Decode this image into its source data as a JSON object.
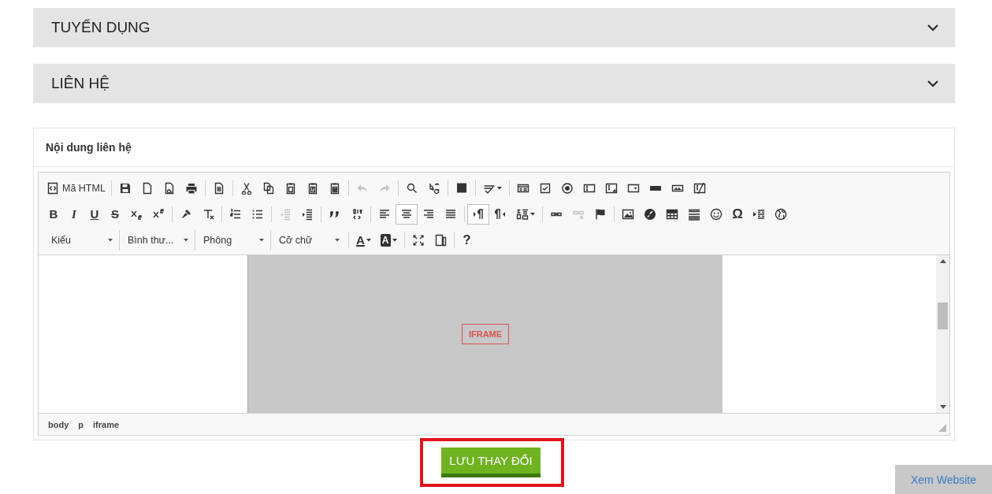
{
  "sections": [
    {
      "title": "TUYỂN DỤNG",
      "expanded": false
    },
    {
      "title": "LIÊN HỆ",
      "expanded": false
    }
  ],
  "editor_card": {
    "title": "Nội dung liên hệ",
    "toolbar": [
      [
        {
          "kind": "button",
          "label": "Mã HTML",
          "on": false,
          "disabled": false
        },
        {
          "kind": "separator"
        },
        {
          "kind": "button",
          "on": false,
          "disabled": false
        },
        {
          "kind": "button",
          "on": false,
          "disabled": false
        },
        {
          "kind": "button",
          "on": false,
          "disabled": false
        },
        {
          "kind": "button",
          "on": false,
          "disabled": false
        },
        {
          "kind": "separator"
        },
        {
          "kind": "button",
          "on": false,
          "disabled": false
        },
        {
          "kind": "separator"
        },
        {
          "kind": "button",
          "on": false,
          "disabled": false
        },
        {
          "kind": "button",
          "on": false,
          "disabled": false
        },
        {
          "kind": "button",
          "on": false,
          "disabled": false
        },
        {
          "kind": "button",
          "on": false,
          "disabled": false
        },
        {
          "kind": "button",
          "on": false,
          "disabled": false
        },
        {
          "kind": "separator"
        },
        {
          "kind": "button",
          "on": false,
          "disabled": true
        },
        {
          "kind": "button",
          "on": false,
          "disabled": true
        },
        {
          "kind": "separator"
        },
        {
          "kind": "button",
          "on": false,
          "disabled": false
        },
        {
          "kind": "button",
          "on": false,
          "disabled": false
        },
        {
          "kind": "separator"
        },
        {
          "kind": "button",
          "on": false,
          "disabled": false
        },
        {
          "kind": "separator"
        },
        {
          "kind": "menu-button",
          "on": false,
          "disabled": false
        },
        {
          "kind": "separator"
        },
        {
          "kind": "button",
          "on": false,
          "disabled": false
        },
        {
          "kind": "button",
          "disabled": false
        },
        {
          "kind": "button",
          "disabled": false
        },
        {
          "kind": "button",
          "on": false,
          "disabled": false
        },
        {
          "kind": "button",
          "on": false,
          "disabled": false
        },
        {
          "kind": "button",
          "on": false,
          "disabled": false
        },
        {
          "kind": "button",
          "on": false,
          "disabled": false
        },
        {
          "kind": "button",
          "on": false,
          "disabled": false
        },
        {
          "kind": "button",
          "on": false,
          "disabled": false
        }
      ],
      [
        {
          "kind": "button",
          "glyph": "B",
          "on": false,
          "disabled": false
        },
        {
          "kind": "button",
          "glyph": "I",
          "on": false,
          "disabled": false
        },
        {
          "kind": "button",
          "glyph": "U",
          "on": false,
          "disabled": false
        },
        {
          "kind": "button",
          "glyph": "S",
          "on": false,
          "disabled": false
        },
        {
          "kind": "button",
          "on": false,
          "disabled": false
        },
        {
          "kind": "button",
          "on": false,
          "disabled": false
        },
        {
          "kind": "separator"
        },
        {
          "kind": "button",
          "on": false,
          "disabled": false
        },
        {
          "kind": "button",
          "on": false,
          "disabled": false
        },
        {
          "kind": "separator"
        },
        {
          "kind": "button",
          "on": false,
          "disabled": false
        },
        {
          "kind": "button",
          "on": false,
          "disabled": false
        },
        {
          "kind": "separator"
        },
        {
          "kind": "button",
          "on": false,
          "disabled": true
        },
        {
          "kind": "button",
          "on": false,
          "disabled": false
        },
        {
          "kind": "separator"
        },
        {
          "kind": "button",
          "on": false,
          "disabled": false
        },
        {
          "kind": "button",
          "on": false,
          "disabled": false
        },
        {
          "kind": "separator"
        },
        {
          "kind": "button",
          "on": false,
          "disabled": false
        },
        {
          "kind": "button",
          "on": true,
          "disabled": false
        },
        {
          "kind": "button",
          "on": false,
          "disabled": false
        },
        {
          "kind": "button",
          "on": false,
          "disabled": false
        },
        {
          "kind": "separator"
        },
        {
          "kind": "button",
          "on": true,
          "disabled": false
        },
        {
          "kind": "button",
          "on": false,
          "disabled": false
        },
        {
          "kind": "menu-button",
          "on": false,
          "disabled": false
        },
        {
          "kind": "separator"
        },
        {
          "kind": "button",
          "on": false,
          "disabled": false
        },
        {
          "kind": "button",
          "on": false,
          "disabled": true
        },
        {
          "kind": "button",
          "on": false,
          "disabled": false
        },
        {
          "kind": "separator"
        },
        {
          "kind": "button",
          "on": false,
          "disabled": false
        },
        {
          "kind": "button",
          "on": false,
          "disabled": false
        },
        {
          "kind": "button",
          "on": false,
          "disabled": false
        },
        {
          "kind": "button",
          "on": false,
          "disabled": false
        },
        {
          "kind": "button",
          "on": false,
          "disabled": false
        },
        {
          "kind": "button",
          "glyph": "Ω",
          "on": false,
          "disabled": false
        },
        {
          "kind": "button",
          "on": false,
          "disabled": false
        },
        {
          "kind": "button",
          "on": false,
          "disabled": false
        }
      ],
      [
        {
          "kind": "combo",
          "label": "Kiểu"
        },
        {
          "kind": "combo",
          "label": "Bình thư..."
        },
        {
          "kind": "combo",
          "label": "Phông"
        },
        {
          "kind": "combo",
          "label": "Cỡ chữ"
        },
        {
          "kind": "separator"
        },
        {
          "kind": "menu-button",
          "glyph": "A",
          "on": false,
          "disabled": false
        },
        {
          "kind": "menu-button",
          "glyph": "A",
          "on": false,
          "disabled": false
        },
        {
          "kind": "separator"
        },
        {
          "kind": "button",
          "on": false,
          "disabled": false
        },
        {
          "kind": "button",
          "on": false,
          "disabled": false
        },
        {
          "kind": "separator"
        },
        {
          "kind": "button",
          "glyph": "?",
          "on": false,
          "disabled": false
        }
      ]
    ],
    "content": {
      "placeholder_label": "IFRAME"
    },
    "path": [
      "body",
      "p",
      "iframe"
    ]
  },
  "save_button": {
    "label": "LƯU THAY ĐỔI",
    "highlighted": true
  },
  "view_website_button": {
    "label": "Xem Website"
  }
}
